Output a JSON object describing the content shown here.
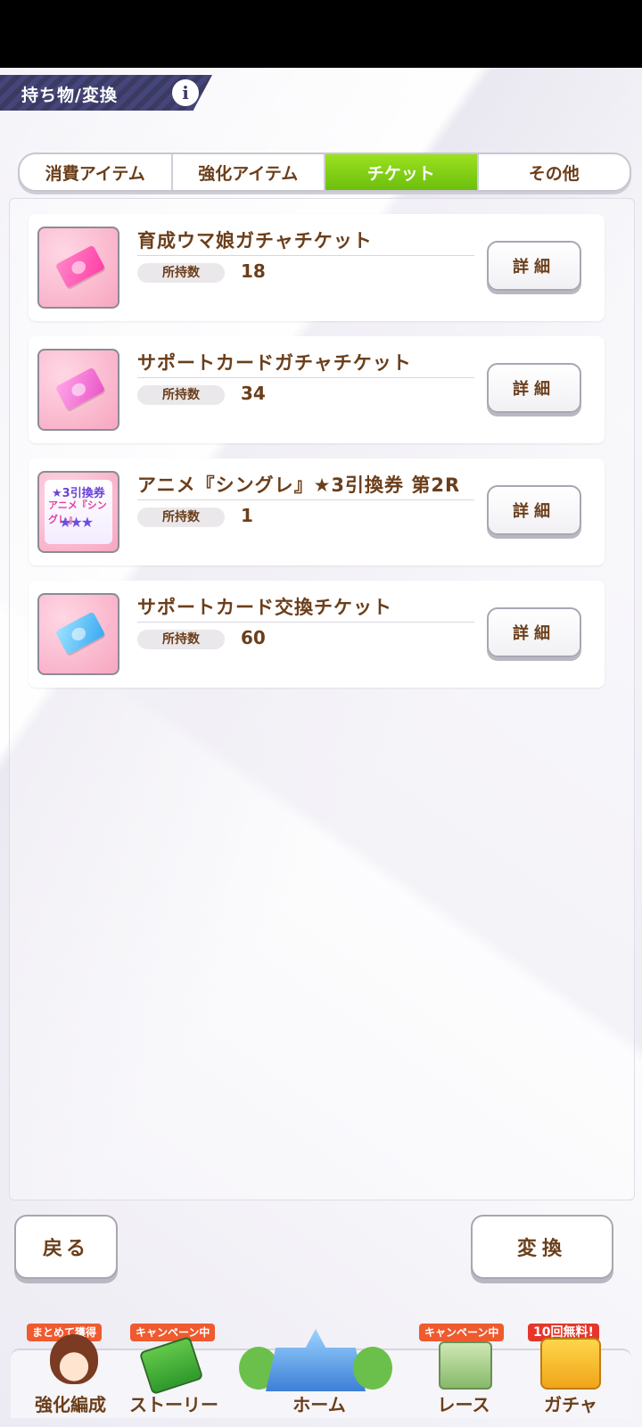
{
  "header": {
    "title": "持ち物/変換",
    "info_icon": "i"
  },
  "tabs": [
    {
      "label": "消費アイテム",
      "active": false
    },
    {
      "label": "強化アイテム",
      "active": false
    },
    {
      "label": "チケット",
      "active": true
    },
    {
      "label": "その他",
      "active": false
    }
  ],
  "items": [
    {
      "name": "育成ウマ娘ガチャチケット",
      "owned_label": "所持数",
      "owned": "18",
      "detail_label": "詳細",
      "icon": "pink-ticket-icon"
    },
    {
      "name": "サポートカードガチャチケット",
      "owned_label": "所持数",
      "owned": "34",
      "detail_label": "詳細",
      "icon": "magenta-ticket-icon"
    },
    {
      "name": "アニメ『シングレ』★3引換券 第2R",
      "owned_label": "所持数",
      "owned": "1",
      "detail_label": "詳細",
      "icon": "anime-ticket-icon",
      "icon_text": [
        "★3引換券",
        "アニメ『シングレ』"
      ]
    },
    {
      "name": "サポートカード交換チケット",
      "owned_label": "所持数",
      "owned": "60",
      "detail_label": "詳細",
      "icon": "blue-ticket-icon"
    }
  ],
  "buttons": {
    "back": "戻る",
    "convert": "変換"
  },
  "nav": [
    {
      "label": "強化編成",
      "badge": "まとめて獲得",
      "icon": "character-icon"
    },
    {
      "label": "ストーリー",
      "badge": "キャンペーン中",
      "icon": "story-book-icon"
    },
    {
      "label": "ホーム",
      "badge": "",
      "icon": "home-school-icon"
    },
    {
      "label": "レース",
      "badge": "キャンペーン中",
      "icon": "race-gate-icon"
    },
    {
      "label": "ガチャ",
      "badge": "10回無料!",
      "icon": "gacha-icon"
    }
  ],
  "colors": {
    "accent_green": "#7ccf14",
    "text_brown": "#6b3e1a",
    "header_navy": "#3b3a63",
    "badge_orange": "#ef5a2f"
  }
}
